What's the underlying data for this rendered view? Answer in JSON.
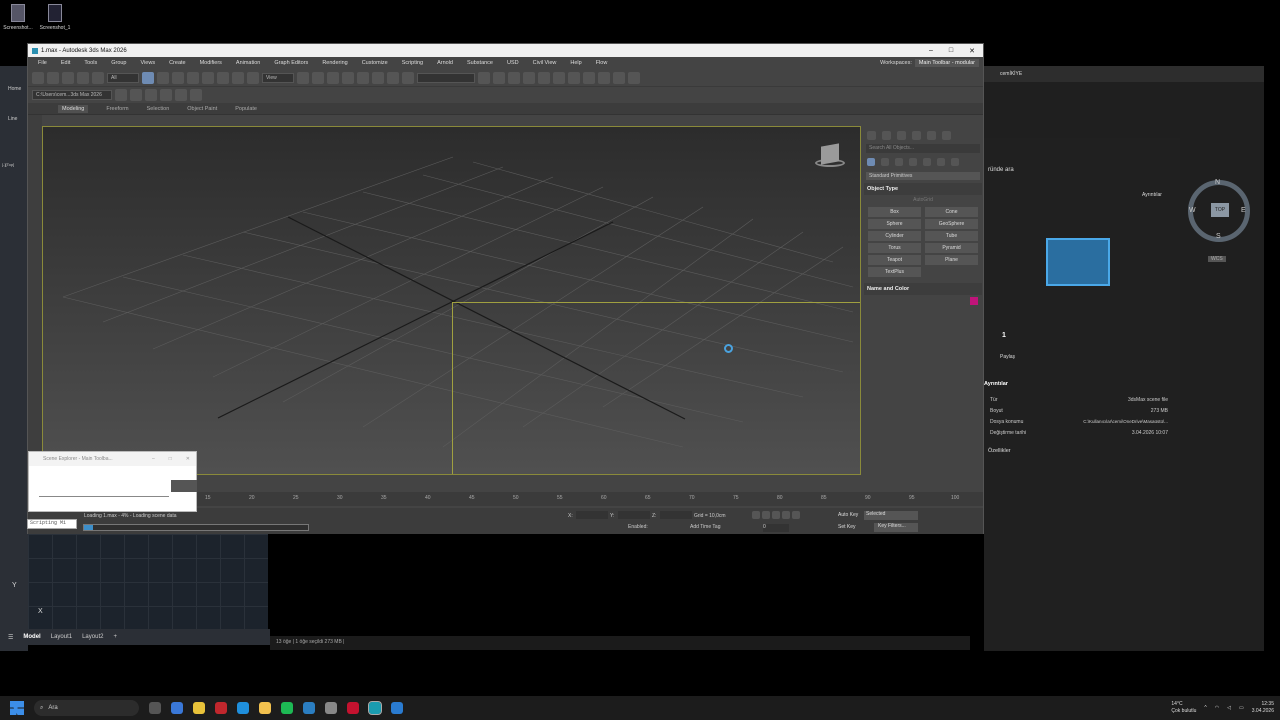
{
  "desktop": {
    "icons": [
      {
        "label": "Screenshot..."
      },
      {
        "label": "Screenshot_1"
      }
    ]
  },
  "acad": {
    "tabs": [
      "Model",
      "Layout1",
      "Layout2"
    ],
    "add": "+",
    "left_home": "Home",
    "left_line": "Line",
    "left_top": "[-][Top]",
    "axis_y": "Y",
    "axis_x": "X"
  },
  "explorer_status": "13 öğe  |  1 öğe seçildi 273 MB  |",
  "right_app": {
    "user": "cemİKİYE",
    "search_hint": "ründe ara",
    "details_btn": "Ayrıntılar",
    "count": "1",
    "share": "Paylaş",
    "section": "Ayrıntılar",
    "details": [
      {
        "k": "Tür",
        "v": "3dsMax scene file"
      },
      {
        "k": "Boyut",
        "v": "273 MB"
      },
      {
        "k": "Dosya konumu",
        "v": "C:\\Kullanıcılar\\cemi\\OneDrive\\Masaüstü\\..."
      },
      {
        "k": "Değiştirme tarihi",
        "v": "3.04.2026 10:07"
      }
    ],
    "props": "Özellikler",
    "viewcube": {
      "top": "TOP",
      "n": "N",
      "s": "S",
      "e": "E",
      "w": "W",
      "wcs": "WCS"
    }
  },
  "max": {
    "title": "1.max - Autodesk 3ds Max 2026",
    "menu": [
      "File",
      "Edit",
      "Tools",
      "Group",
      "Views",
      "Create",
      "Modifiers",
      "Animation",
      "Graph Editors",
      "Rendering",
      "Customize",
      "Scripting",
      "Arnold",
      "Substance",
      "USD",
      "Civil View",
      "Help",
      "Flow"
    ],
    "workspaces_label": "Workspaces:",
    "workspace": "Main Toolbar - modular",
    "filter": "All",
    "view": "View",
    "path": "C:\\Users\\cem...3ds Max 2026",
    "ribbon": [
      "Modeling",
      "Freeform",
      "Selection",
      "Object Paint",
      "Populate"
    ],
    "cmd": {
      "search": "Search All Objects...",
      "category": "Standard Primitives",
      "object_type": "Object Type",
      "autogrid": "AutoGrid",
      "prims": [
        "Box",
        "Cone",
        "Sphere",
        "GeoSphere",
        "Cylinder",
        "Tube",
        "Torus",
        "Pyramid",
        "Teapot",
        "Plane",
        "TextPlus"
      ],
      "name_color": "Name and Color",
      "obj_color": "#c0147a"
    },
    "timeline": [
      "15",
      "20",
      "25",
      "30",
      "35",
      "40",
      "45",
      "50",
      "55",
      "60",
      "65",
      "70",
      "75",
      "80",
      "85",
      "90",
      "95",
      "100"
    ],
    "status": {
      "loading": "Loading 1.max  -  4%  -  Loading scene data",
      "progress": 0.04,
      "x": "X:",
      "y": "Y:",
      "z": "Z:",
      "grid": "Grid = 10,0cm",
      "enabled": "Enabled:",
      "add_time_tag": "Add Time Tag",
      "auto_key": "Auto Key",
      "set_key": "Set Key",
      "selected": "Selected",
      "key_filters": "Key Filters...",
      "frame": "0"
    },
    "scene_explorer": "Scene Explorer - Main Toolba...",
    "scripting": "Scripting Mi"
  },
  "taskbar": {
    "search": "Ara",
    "weather_temp": "14°C",
    "weather_desc": "Çok bulutlu",
    "time": "12:35",
    "date": "3.04.2026"
  }
}
